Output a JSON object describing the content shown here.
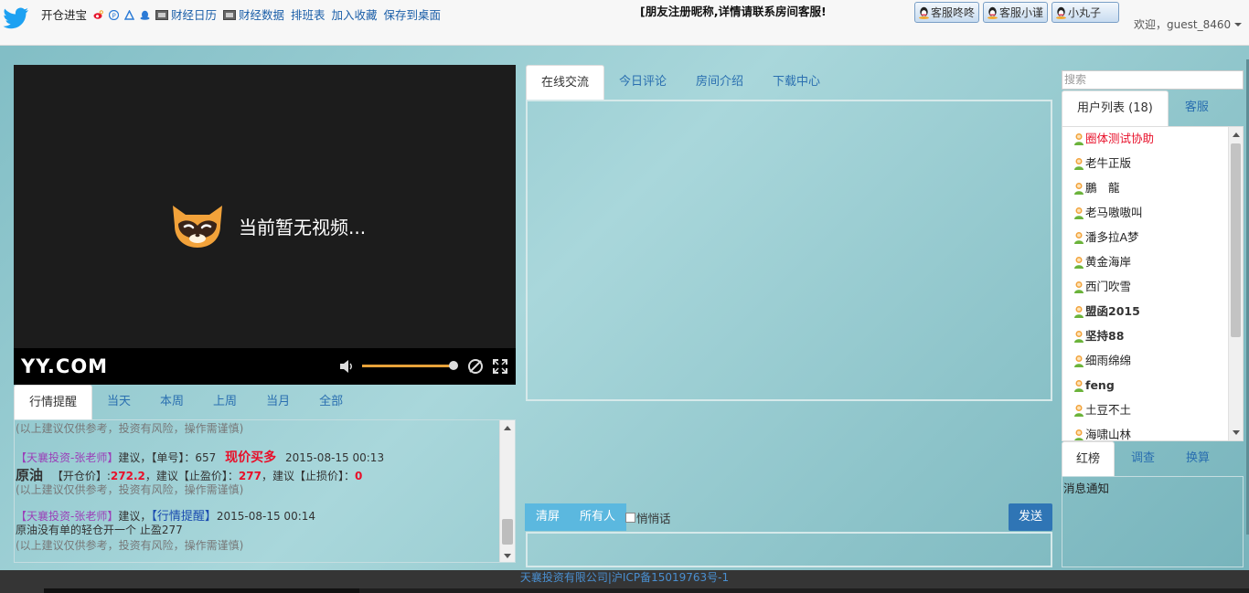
{
  "header": {
    "site_name": "开仓进宝",
    "links": [
      "财经日历",
      "财经数据",
      "排班表",
      "加入收藏",
      "保存到桌面"
    ],
    "notice": "[朋友注册昵称,详情请联系房间客服!",
    "service_buttons": [
      "客服咚咚",
      "客服小谨",
      "小丸子"
    ],
    "welcome": "欢迎，guest_8460"
  },
  "video": {
    "message": "当前暂无视频...",
    "brand": "YY.COM",
    "volume_fraction": 0.95
  },
  "market_tabs": [
    "行情提醒",
    "当天",
    "本周",
    "上周",
    "当月",
    "全部"
  ],
  "market": {
    "disclaimer": "(以上建议仅供参考，投资有风险，操作需谨慎)",
    "entry1": {
      "author": "【天襄投资-张老师】",
      "suggest": "建议，",
      "order_label": "【单号】：",
      "order_no": "657",
      "action": "现价买多",
      "time": "2015-08-15 00:13",
      "product": "原油",
      "open_label": "【开仓价】:",
      "open_price": "272.2",
      "tp_label": "，建议【止盈价】：",
      "tp_price": "277",
      "sl_label": "，建议【止损价】：",
      "sl_price": "0"
    },
    "entry2": {
      "author": "【天襄投资-张老师】",
      "suggest": "建议，",
      "tag": "【行情提醒】",
      "time": "2015-08-15 00:14",
      "content": "原油没有单的轻仓开一个 止盈277"
    }
  },
  "chat_tabs": [
    "在线交流",
    "今日评论",
    "房间介绍",
    "下载中心"
  ],
  "chat_tools": {
    "clear": "清屏",
    "target": "所有人",
    "whisper": "悄悄话",
    "send": "发送"
  },
  "sidebar": {
    "search_placeholder": "搜索",
    "tabs": [
      "用户列表 (18)",
      "客服"
    ],
    "users": [
      {
        "name": "圈体测试协助",
        "color": "#e8102a",
        "bold": false
      },
      {
        "name": "老牛正版",
        "color": "#222222",
        "bold": false
      },
      {
        "name": "鵬　龍",
        "color": "#222222",
        "bold": false
      },
      {
        "name": "老马嗷嗷叫",
        "color": "#222222",
        "bold": false
      },
      {
        "name": "潘多拉A梦",
        "color": "#222222",
        "bold": false
      },
      {
        "name": "黄金海岸",
        "color": "#222222",
        "bold": false
      },
      {
        "name": "西门吹雪",
        "color": "#222222",
        "bold": false
      },
      {
        "name": "盟函2015",
        "color": "#333333",
        "bold": true
      },
      {
        "name": "坚持88",
        "color": "#333333",
        "bold": true
      },
      {
        "name": "细雨绵绵",
        "color": "#222222",
        "bold": false
      },
      {
        "name": "feng",
        "color": "#333333",
        "bold": true
      },
      {
        "name": "土豆不土",
        "color": "#222222",
        "bold": false
      },
      {
        "name": "海啸山林",
        "color": "#222222",
        "bold": false
      }
    ],
    "bottom_tabs": [
      "红榜",
      "调查",
      "换算"
    ],
    "notify_title": "消息通知"
  },
  "footer": {
    "text": "天襄投资有限公司|沪ICP备15019763号-1"
  }
}
